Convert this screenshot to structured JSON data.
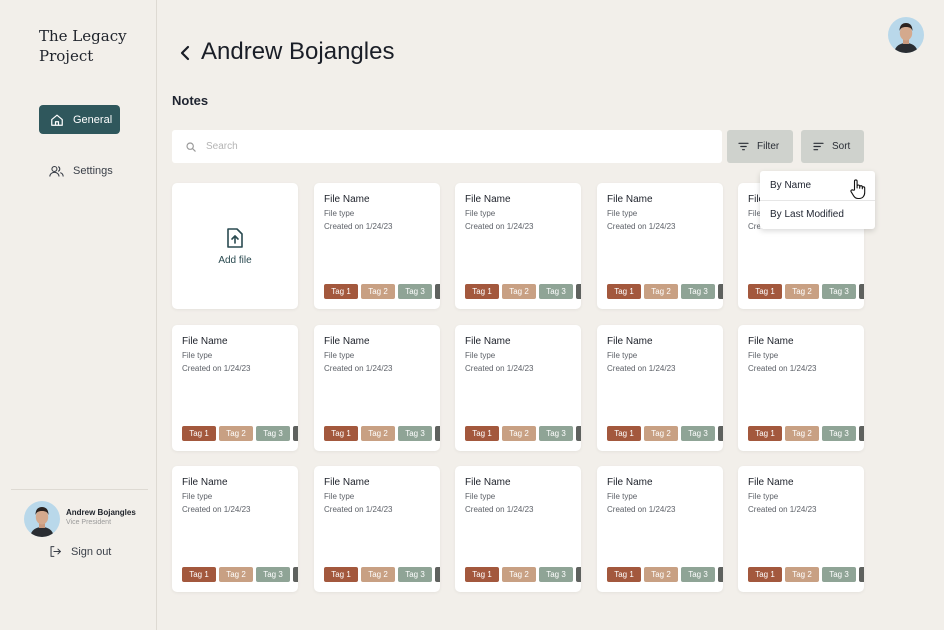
{
  "sidebar": {
    "brand": "The Legacy Project",
    "nav": {
      "general": "General",
      "settings": "Settings"
    },
    "user": {
      "name": "Andrew Bojangles",
      "role": "Vice President"
    },
    "signout": "Sign out"
  },
  "header": {
    "title": "Andrew Bojangles"
  },
  "notes": {
    "title": "Notes",
    "search_placeholder": "Search",
    "filter_label": "Filter",
    "sort_label": "Sort",
    "sort_options": [
      "By Name",
      "By Last Modified"
    ],
    "add_file_label": "Add file",
    "card": {
      "file_name": "File Name",
      "file_type": "File type",
      "created": "Created on 1/24/23",
      "tags": [
        "Tag 1",
        "Tag 2",
        "Tag 3"
      ]
    }
  },
  "colors": {
    "accent": "#2f575c",
    "tag1": "#a3583d",
    "tag2": "#c8a083",
    "tag3": "#8fa496",
    "tag4": "#5e615e",
    "background": "#f2efea"
  }
}
